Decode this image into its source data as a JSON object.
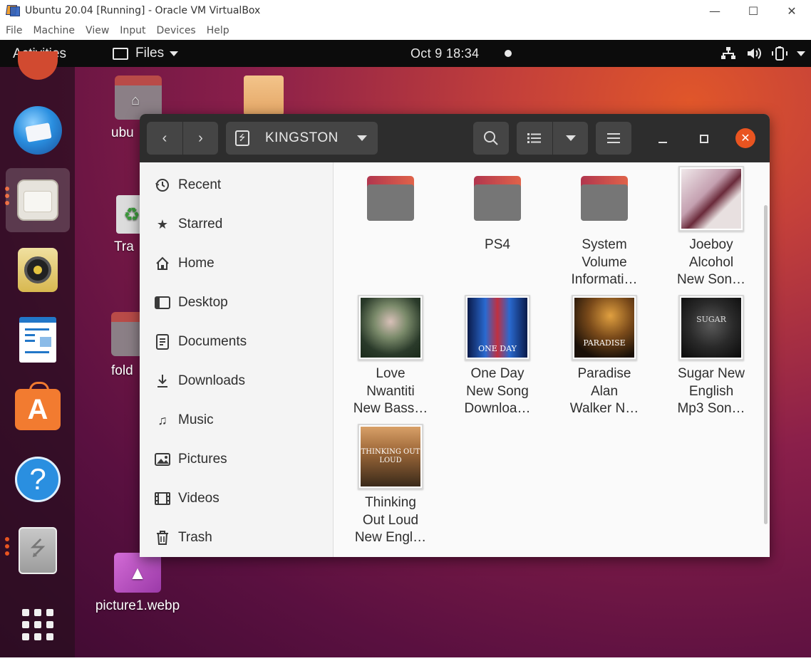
{
  "host_window": {
    "title": "Ubuntu 20.04 [Running] - Oracle VM VirtualBox",
    "controls": {
      "minimize": "—",
      "maximize": "☐",
      "close": "✕"
    },
    "menu": [
      "File",
      "Machine",
      "View",
      "Input",
      "Devices",
      "Help"
    ]
  },
  "topbar": {
    "activities": "Activities",
    "app_menu": "Files",
    "clock": "Oct 9  18:34"
  },
  "desktop_icons": {
    "home_label": "ubu",
    "trash_label": "Tra",
    "folder_label": "fold",
    "picture_label": "picture1.webp"
  },
  "files_window": {
    "location": "KINGSTON",
    "sidebar": [
      {
        "label": "Recent",
        "icon": "clock-icon"
      },
      {
        "label": "Starred",
        "icon": "star-icon"
      },
      {
        "label": "Home",
        "icon": "home-icon"
      },
      {
        "label": "Desktop",
        "icon": "desktop-icon"
      },
      {
        "label": "Documents",
        "icon": "document-icon"
      },
      {
        "label": "Downloads",
        "icon": "download-icon"
      },
      {
        "label": "Music",
        "icon": "music-icon"
      },
      {
        "label": "Pictures",
        "icon": "picture-icon"
      },
      {
        "label": "Videos",
        "icon": "video-icon"
      },
      {
        "label": "Trash",
        "icon": "trash-icon"
      }
    ],
    "items": [
      {
        "type": "folder",
        "l1": "",
        "l2": "",
        "l3": ""
      },
      {
        "type": "folder",
        "l1": "PS4",
        "l2": "",
        "l3": ""
      },
      {
        "type": "folder",
        "l1": "System",
        "l2": "Volume",
        "l3": "Informati…"
      },
      {
        "type": "image",
        "l1": "Joeboy",
        "l2": "Alcohol",
        "l3": "New Son…"
      },
      {
        "type": "image",
        "l1": "Love",
        "l2": "Nwantiti",
        "l3": "New Bass…"
      },
      {
        "type": "image",
        "l1": "One Day",
        "l2": "New Song",
        "l3": "Downloa…",
        "thumb_text": "ONE DAY"
      },
      {
        "type": "image",
        "l1": "Paradise",
        "l2": "Alan",
        "l3": "Walker N…",
        "thumb_text": "PARADISE"
      },
      {
        "type": "image",
        "l1": "Sugar New",
        "l2": "English",
        "l3": "Mp3 Son…",
        "thumb_text": "SUGAR"
      },
      {
        "type": "image",
        "l1": "Thinking",
        "l2": "Out Loud",
        "l3": "New Engl…",
        "thumb_text": "THINKING OUT LOUD"
      }
    ]
  },
  "colors": {
    "accent": "#e95420",
    "topbar": "#0c0c0c",
    "header": "#2d2d2d"
  }
}
